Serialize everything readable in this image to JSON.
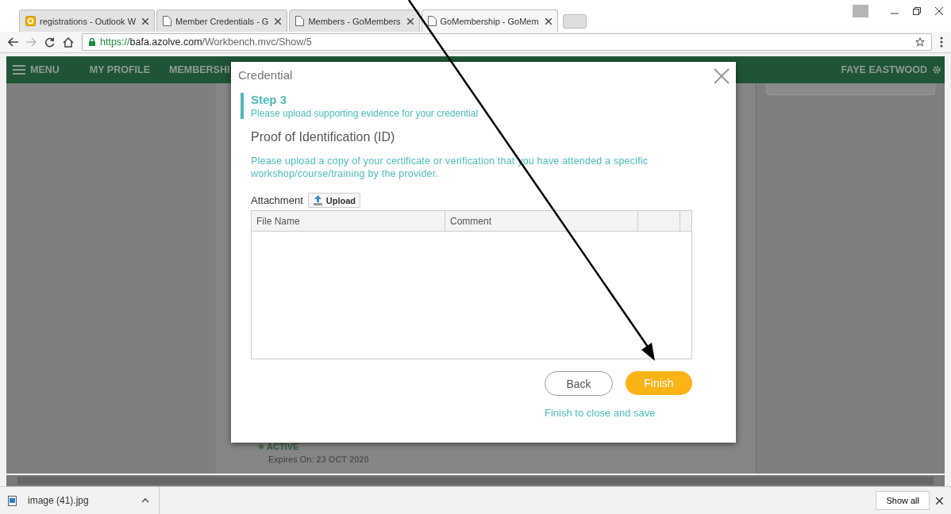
{
  "browser": {
    "tabs": [
      {
        "kind": "outlook",
        "title": "registrations - Outlook W",
        "selected": false
      },
      {
        "kind": "page",
        "title": "Member Credentials - G",
        "selected": false
      },
      {
        "kind": "page",
        "title": "Members - GoMembers",
        "selected": false
      },
      {
        "kind": "page",
        "title": "GoMembership - GoMem",
        "selected": true
      }
    ],
    "url": {
      "scheme": "https://",
      "host": "bafa.azolve.com",
      "path": "/Workbench.mvc/Show/5"
    }
  },
  "nav": {
    "menu": "MENU",
    "items": [
      "MY PROFILE",
      "MEMBERSHI"
    ],
    "user": "FAYE EASTWOOD"
  },
  "background": {
    "status": "ACTIVE",
    "expires_label": "Expires On:",
    "expires_value": "23 OCT 2020"
  },
  "dialog": {
    "title": "Credential",
    "step": "Step 3",
    "step_hint": "Please upload supporting evidence for your credential",
    "heading": "Proof of Identification (ID)",
    "instructions": "Please upload a copy of your certificate or verification that you have attended a specific workshop/course/training by the provider.",
    "attachment_label": "Attachment",
    "upload_button": "Upload",
    "columns": [
      "File Name",
      "Comment"
    ],
    "back_button": "Back",
    "finish_button": "Finish",
    "finish_hint": "Finish to close and save"
  },
  "downloads": {
    "file": "image (41).jpg",
    "show_all": "Show all"
  }
}
